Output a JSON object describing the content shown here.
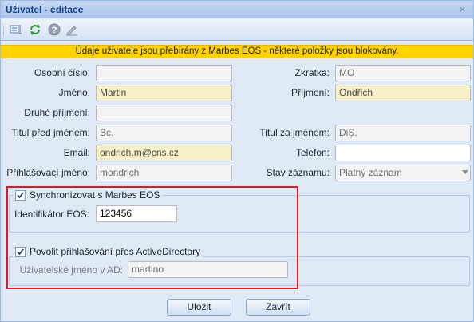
{
  "window": {
    "title": "Uživatel - editace",
    "close_glyph": "×"
  },
  "toolbar": {
    "icons": [
      "properties-icon",
      "refresh-icon",
      "help-icon",
      "edit-icon"
    ]
  },
  "notice": "Údaje uživatele jsou přebírány z Marbes EOS - některé položky jsou blokovány.",
  "form": {
    "osobni_cislo": {
      "label": "Osobní číslo:",
      "value": ""
    },
    "zkratka": {
      "label": "Zkratka:",
      "value": "MO"
    },
    "jmeno": {
      "label": "Jméno:",
      "value": "Martin"
    },
    "prijmeni": {
      "label": "Příjmení:",
      "value": "Ondřich"
    },
    "druhe_prijmeni": {
      "label": "Druhé příjmení:",
      "value": ""
    },
    "titul_pred": {
      "label": "Titul před jménem:",
      "value": "Bc."
    },
    "titul_za": {
      "label": "Titul za jménem:",
      "value": "DiS."
    },
    "email": {
      "label": "Email:",
      "value": "ondrich.m@cns.cz"
    },
    "telefon": {
      "label": "Telefon:",
      "value": ""
    },
    "prihlasovaci_jmeno": {
      "label": "Přihlašovací jméno:",
      "value": "mondrich"
    },
    "stav_zaznamu": {
      "label": "Stav záznamu:",
      "value": "Platný záznam"
    }
  },
  "sync_group": {
    "legend": "Synchronizovat s Marbes EOS",
    "checked": true,
    "identifikator": {
      "label": "Identifikátor EOS:",
      "value": "123456"
    }
  },
  "ad_group": {
    "legend": "Povolit přihlašování přes ActiveDirectory",
    "checked": true,
    "ad_name": {
      "label": "Uživatelské jméno v AD:",
      "value": "martino"
    }
  },
  "buttons": {
    "save": "Uložit",
    "close": "Zavřít"
  },
  "colors": {
    "notice_bg": "#ffd200",
    "locked_field_bg": "#f7efc8",
    "highlight_border": "#e3171f",
    "window_bg": "#dfe8f5"
  }
}
